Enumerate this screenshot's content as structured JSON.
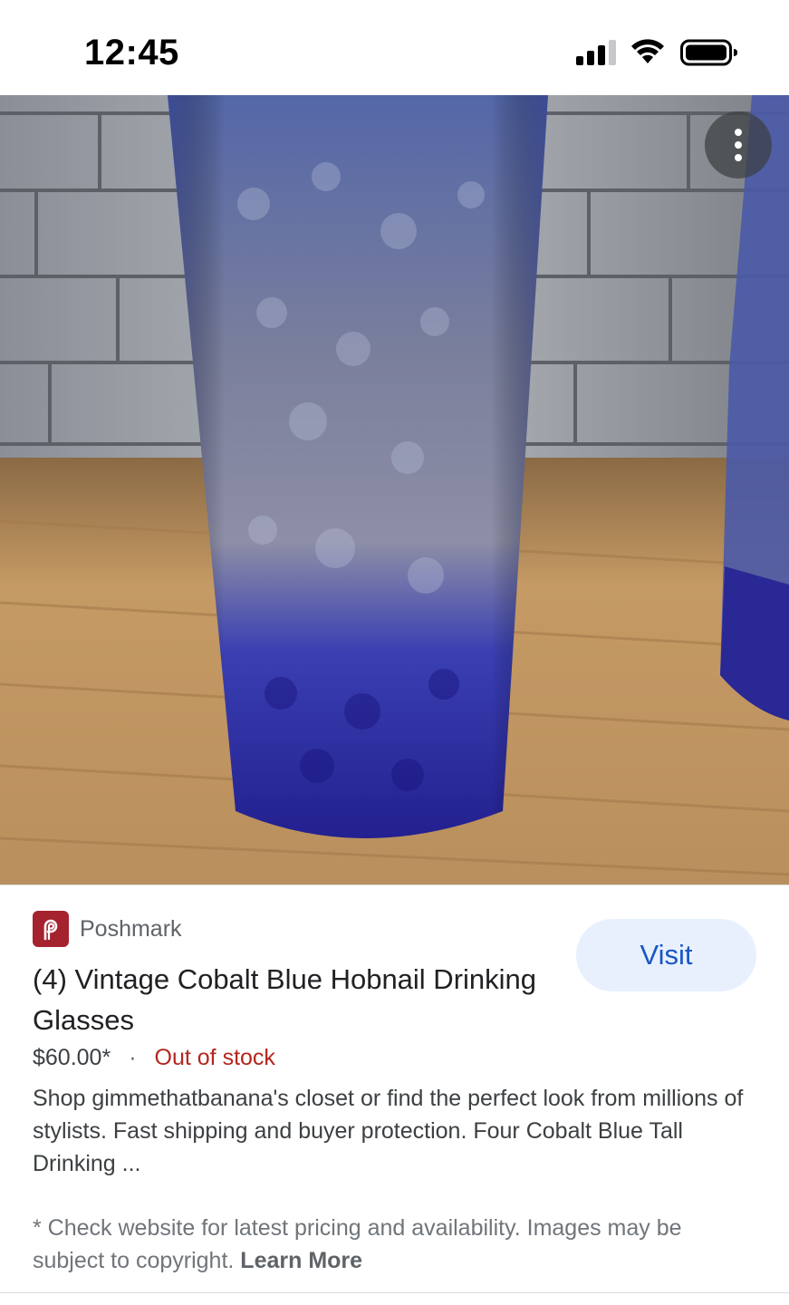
{
  "status_bar": {
    "time": "12:45",
    "icons": [
      "signal-icon",
      "wifi-icon",
      "battery-icon"
    ]
  },
  "hero_image": {
    "alt": "Cobalt blue hobnail drinking glass",
    "menu_icon": "more-vert-icon"
  },
  "result": {
    "source": "Poshmark",
    "source_icon": "poshmark-logo-icon",
    "visit_label": "Visit",
    "title": "(4) Vintage Cobalt Blue Hobnail Drinking Glasses",
    "price": "$60.00*",
    "separator": "·",
    "availability": "Out of stock",
    "description": "Shop gimmethatbanana's closet or find the perfect look from millions of stylists. Fast shipping and buyer protection. Four Cobalt Blue Tall Drinking ...",
    "disclaimer": "* Check website for latest pricing and availability. Images may be subject to copyright.",
    "learn_more": "Learn More"
  },
  "colors": {
    "accent": "#1a56c4",
    "visit_bg": "#e8f0fe",
    "out_of_stock": "#b3261e",
    "brand": "#a5232f"
  }
}
